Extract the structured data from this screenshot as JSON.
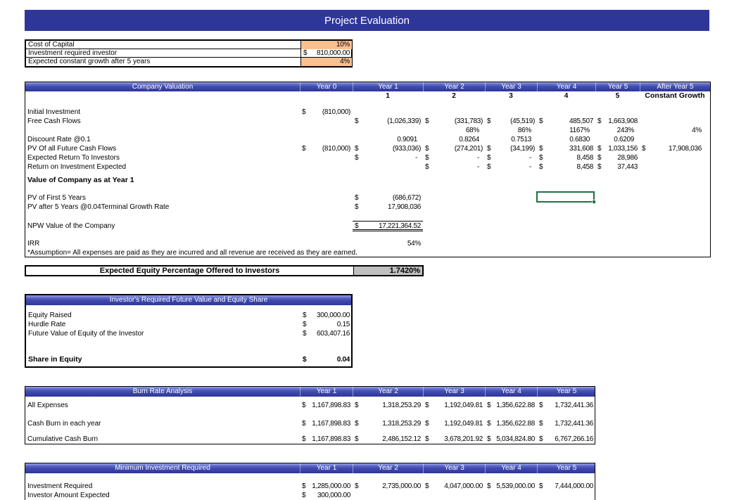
{
  "banner": {
    "title": "Project Evaluation"
  },
  "colors": {
    "banner_blue": "#2F3699",
    "header_gradient_dark": "#2E3192",
    "highlight_orange": "#FAC090",
    "value_gray": "#BFBFBF",
    "selection_green": "#1E7145"
  },
  "assumptions": {
    "rows": [
      {
        "label": "Cost of Capital",
        "value": "10%"
      },
      {
        "label": "Investment required investor",
        "d": "$",
        "value": "810,000.00"
      },
      {
        "label": "Expected constant growth after 5 years",
        "value": "4%"
      }
    ]
  },
  "valuation": {
    "title": "Company Valuation",
    "col_headers": [
      "Year 0",
      "Year 1",
      "Year 2",
      "Year 3",
      "Year 4",
      "Year 5",
      "After Year 5"
    ],
    "numbers_row": {
      "y1": "1",
      "y2": "2",
      "y3": "3",
      "y4": "4",
      "y5": "5",
      "after": "Constant Growth"
    },
    "rows": [
      {
        "label": "Initial Investment",
        "cells": {
          "y0": {
            "d": "$",
            "v": "(810,000)"
          }
        }
      },
      {
        "label": "Free Cash Flows",
        "cells": {
          "y1": {
            "d": "$",
            "v": "(1,026,339)"
          },
          "y2": {
            "d": "$",
            "v": "(331,783)"
          },
          "y3": {
            "d": "$",
            "v": "(45,519)"
          },
          "y4": {
            "d": "$",
            "v": "485,507"
          },
          "y5": {
            "d": "$",
            "v": "1,663,908"
          }
        }
      },
      {
        "label": "",
        "cells": {
          "y2": {
            "v": "68%"
          },
          "y3": {
            "v": "86%"
          },
          "y4": {
            "v": "1167%"
          },
          "y5": {
            "v": "243%"
          },
          "after": {
            "v": "4%"
          }
        }
      },
      {
        "label": "Discount Rate @0.1",
        "cells": {
          "y1": {
            "v": "0.9091"
          },
          "y2": {
            "v": "0.8264"
          },
          "y3": {
            "v": "0.7513"
          },
          "y4": {
            "v": "0.6830"
          },
          "y5": {
            "v": "0.6209"
          }
        }
      },
      {
        "label": "PV Of all Future Cash Flows",
        "cells": {
          "y0": {
            "d": "$",
            "v": "(810,000)"
          },
          "y1": {
            "d": "$",
            "v": "(933,036)"
          },
          "y2": {
            "d": "$",
            "v": "(274,201)"
          },
          "y3": {
            "d": "$",
            "v": "(34,199)"
          },
          "y4": {
            "d": "$",
            "v": "331,608"
          },
          "y5": {
            "d": "$",
            "v": "1,033,156"
          },
          "after": {
            "d": "$",
            "v": "17,908,036"
          }
        }
      },
      {
        "label": "Expected Return To Investors",
        "cells": {
          "y1": {
            "d": "$",
            "v": "-"
          },
          "y2": {
            "d": "$",
            "v": "-"
          },
          "y3": {
            "d": "$",
            "v": "-"
          },
          "y4": {
            "d": "$",
            "v": "8,458"
          },
          "y5": {
            "d": "$",
            "v": "28,986"
          }
        }
      },
      {
        "label": "Return on Investment Expected",
        "cells": {
          "y2": {
            "d": "$",
            "v": "-"
          },
          "y3": {
            "d": "$",
            "v": "-"
          },
          "y4": {
            "d": "$",
            "v": "8,458"
          },
          "y5": {
            "d": "$",
            "v": "37,443"
          }
        }
      }
    ],
    "value_section": {
      "heading": "Value of Company as at Year 1",
      "rows": [
        {
          "label": "PV of First 5 Years",
          "d": "$",
          "v": "(686,672)"
        },
        {
          "label": "PV after 5 Years @0.04Terminal Growth Rate",
          "d": "$",
          "v": "17,908,036"
        }
      ],
      "npw": {
        "label": "NPW Value of the Company",
        "d": "$",
        "v": "17,221,364.52"
      },
      "irr": {
        "label": "IRR",
        "v": "54%"
      },
      "note": "*Assumption= All expenses are paid as they are incurred and all revenue are received as they are earned."
    }
  },
  "equity_offer": {
    "label": "Expected Equity Percentage Offered to Investors",
    "value": "1.7420%"
  },
  "investor": {
    "title": "Investor's Required Future Value and Equity Share",
    "rows": [
      {
        "label": "Equity Raised",
        "d": "$",
        "v": "300,000.00"
      },
      {
        "label": "Hurdle Rate",
        "d": "$",
        "v": "0.15"
      },
      {
        "label": "Future Value of Equity of the Investor",
        "d": "$",
        "v": "603,407.16"
      }
    ],
    "share": {
      "label": "Share in Equity",
      "d": "$",
      "v": "0.04"
    }
  },
  "burn": {
    "title": "Burn Rate Analysis",
    "col_headers": [
      "Year 1",
      "Year 2",
      "Year 3",
      "Year 4",
      "Year 5"
    ],
    "rows": [
      {
        "label": "All Expenses",
        "cells": [
          {
            "d": "$",
            "v": "1,167,898.83"
          },
          {
            "d": "$",
            "v": "1,318,253.29"
          },
          {
            "d": "$",
            "v": "1,192,049.81"
          },
          {
            "d": "$",
            "v": "1,356,622.88"
          },
          {
            "d": "$",
            "v": "1,732,441.36"
          }
        ]
      },
      {
        "label": "Cash Burn in each year",
        "cells": [
          {
            "d": "$",
            "v": "1,167,898.83"
          },
          {
            "d": "$",
            "v": "1,318,253.29"
          },
          {
            "d": "$",
            "v": "1,192,049.81"
          },
          {
            "d": "$",
            "v": "1,356,622.88"
          },
          {
            "d": "$",
            "v": "1,732,441.36"
          }
        ]
      },
      {
        "label": "Cumulative Cash Burn",
        "cells": [
          {
            "d": "$",
            "v": "1,167,898.83"
          },
          {
            "d": "$",
            "v": "2,486,152.12"
          },
          {
            "d": "$",
            "v": "3,678,201.92"
          },
          {
            "d": "$",
            "v": "5,034,824.80"
          },
          {
            "d": "$",
            "v": "6,767,266.16"
          }
        ]
      }
    ]
  },
  "minimum_investment": {
    "title": "Minimum Investment Required",
    "col_headers": [
      "Year 1",
      "Year 2",
      "Year 3",
      "Year 4",
      "Year 5"
    ],
    "rows": [
      {
        "label": "Investment Required",
        "cells": [
          {
            "d": "$",
            "v": "1,285,000.00"
          },
          {
            "d": "$",
            "v": "2,735,000.00"
          },
          {
            "d": "$",
            "v": "4,047,000.00"
          },
          {
            "d": "$",
            "v": "5,539,000.00"
          },
          {
            "d": "$",
            "v": "7,444,000.00"
          }
        ]
      },
      {
        "label": "Investor Amount Expected",
        "cells": [
          {
            "d": "$",
            "v": "300,000.00"
          }
        ]
      }
    ]
  }
}
